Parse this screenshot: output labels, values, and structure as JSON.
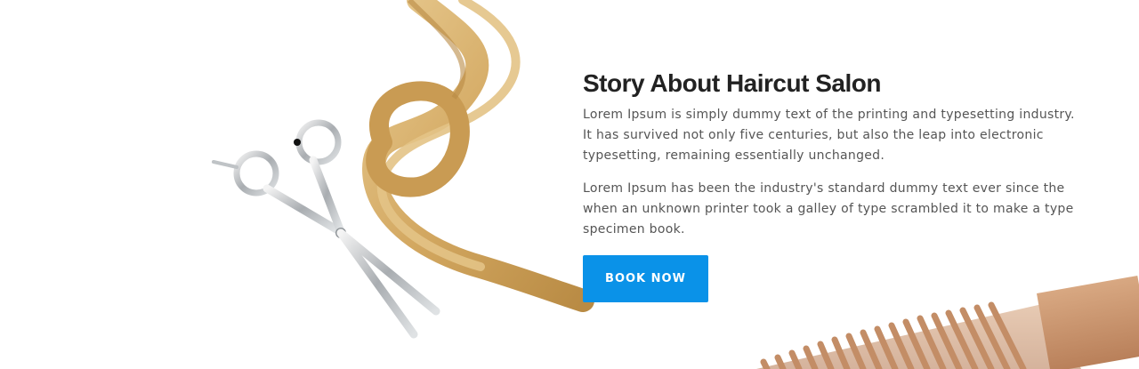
{
  "story": {
    "title": "Story About Haircut Salon",
    "paragraph1": "Lorem Ipsum is simply dummy text of the printing and typesetting industry. It has survived not only five centuries, but also the leap into electronic typesetting, remaining essentially unchanged.",
    "paragraph2": "Lorem Ipsum has been the industry's standard dummy text ever since the when an unknown printer took a galley of type scrambled it to make a type specimen book.",
    "button_label": "BOOK NOW"
  },
  "colors": {
    "accent": "#0a92e8",
    "heading": "#222222",
    "body_text": "#555555",
    "hair": "#d9b06a",
    "comb": "#c8916a"
  },
  "decor": {
    "images": [
      "scissors-illustration",
      "hair-strand-illustration",
      "wooden-comb-illustration"
    ]
  }
}
